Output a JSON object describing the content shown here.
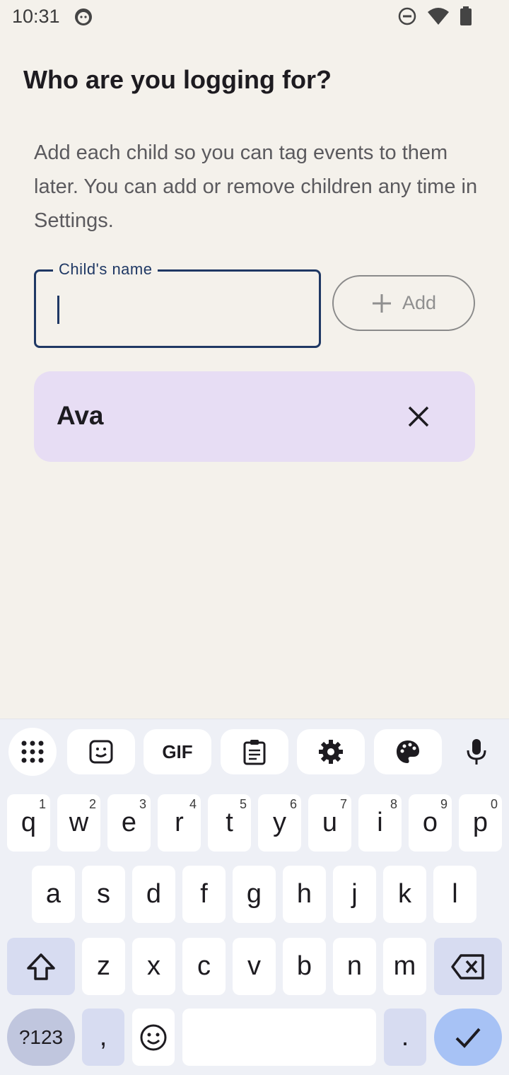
{
  "status_bar": {
    "time": "10:31"
  },
  "page": {
    "title": "Who are you logging for?",
    "description": "Add each child so you can tag events to them later. You can add or remove children any time in Settings."
  },
  "form": {
    "name_label": "Child's name",
    "name_value": "",
    "add_label": "Add"
  },
  "children": [
    {
      "name": "Ava"
    }
  ],
  "keyboard": {
    "toolbar": [
      "apps-icon",
      "sticker-icon",
      "GIF",
      "clipboard-icon",
      "settings-icon",
      "palette-icon",
      "mic-icon"
    ],
    "gif_label": "GIF",
    "row1": [
      {
        "k": "q",
        "h": "1"
      },
      {
        "k": "w",
        "h": "2"
      },
      {
        "k": "e",
        "h": "3"
      },
      {
        "k": "r",
        "h": "4"
      },
      {
        "k": "t",
        "h": "5"
      },
      {
        "k": "y",
        "h": "6"
      },
      {
        "k": "u",
        "h": "7"
      },
      {
        "k": "i",
        "h": "8"
      },
      {
        "k": "o",
        "h": "9"
      },
      {
        "k": "p",
        "h": "0"
      }
    ],
    "row2": [
      "a",
      "s",
      "d",
      "f",
      "g",
      "h",
      "j",
      "k",
      "l"
    ],
    "row3": [
      "z",
      "x",
      "c",
      "v",
      "b",
      "n",
      "m"
    ],
    "symbols_label": "?123",
    "comma": ",",
    "period": "."
  },
  "colors": {
    "background": "#f4f1eb",
    "accent": "#1f3864",
    "chip": "#e7ddf4",
    "enter_key": "#a7c2f5"
  }
}
